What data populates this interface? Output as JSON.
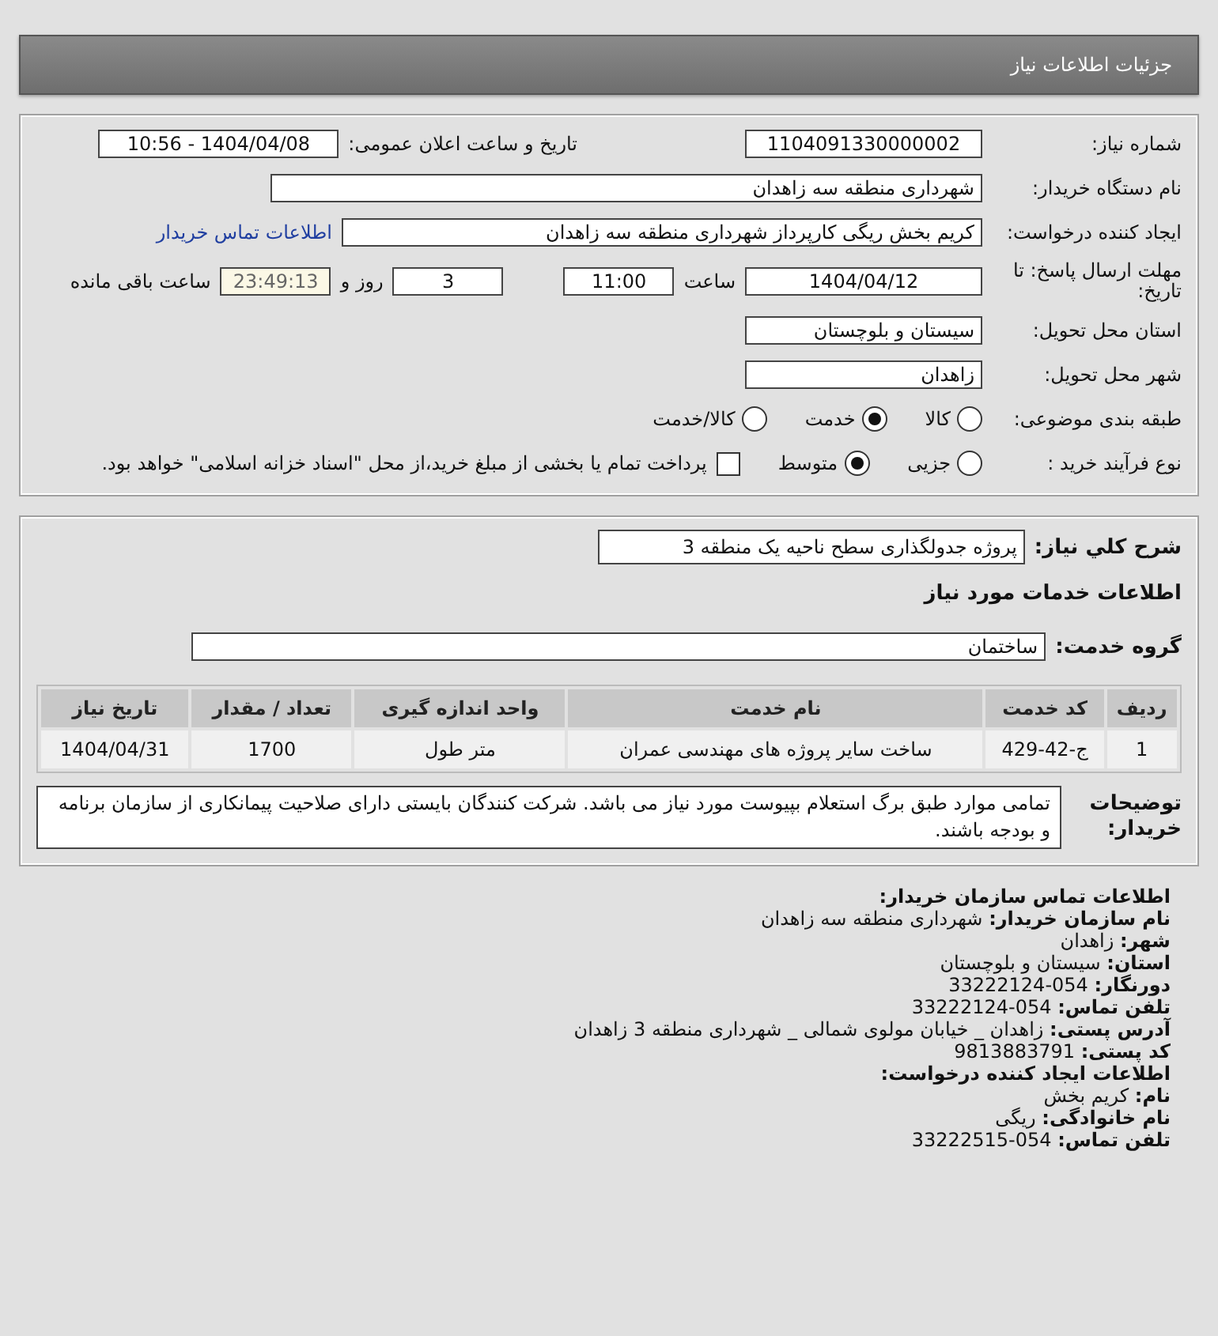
{
  "header": {
    "title": "جزئیات اطلاعات نیاز"
  },
  "details": {
    "need_number": {
      "label": "شماره نیاز:",
      "value": "1104091330000002"
    },
    "announce": {
      "label": "تاریخ و ساعت اعلان عمومی:",
      "value": "1404/04/08 - 10:56"
    },
    "buyer": {
      "label": "نام دستگاه خریدار:",
      "value": "شهرداری منطقه سه زاهدان"
    },
    "requester": {
      "label": "ایجاد کننده درخواست:",
      "value": "کریم بخش ریگی کارپرداز شهرداری منطقه سه زاهدان",
      "link": "اطلاعات تماس خریدار"
    },
    "deadline": {
      "label": "مهلت ارسال پاسخ: تا تاریخ:",
      "date": "1404/04/12",
      "time_label": "ساعت",
      "time": "11:00",
      "days": "3",
      "days_label": "روز و",
      "remaining": "23:49:13",
      "remaining_label": "ساعت باقی مانده"
    },
    "province": {
      "label": "استان محل تحویل:",
      "value": "سیستان و بلوچستان"
    },
    "city": {
      "label": "شهر محل تحویل:",
      "value": "زاهدان"
    },
    "category": {
      "label": "طبقه بندی موضوعی:",
      "options": [
        {
          "label": "کالا",
          "selected": false
        },
        {
          "label": "خدمت",
          "selected": true
        },
        {
          "label": "کالا/خدمت",
          "selected": false
        }
      ]
    },
    "process": {
      "label": "نوع فرآیند خرید :",
      "options": [
        {
          "label": "جزیی",
          "selected": false
        },
        {
          "label": "متوسط",
          "selected": true
        }
      ],
      "payment": {
        "checked": false,
        "label": "پرداخت تمام یا بخشی از مبلغ خرید،از محل \"اسناد خزانه اسلامی\" خواهد بود."
      }
    }
  },
  "summary": {
    "description": {
      "label": "شرح کلي نیاز:",
      "value": "پروژه جدولگذاری سطح ناحیه یک منطقه 3"
    },
    "services_title": "اطلاعات خدمات مورد نیاز",
    "group": {
      "label": "گروه خدمت:",
      "value": "ساختمان"
    },
    "table": {
      "columns": [
        "ردیف",
        "کد خدمت",
        "نام خدمت",
        "واحد اندازه گیری",
        "تعداد / مقدار",
        "تاریخ نیاز"
      ],
      "rows": [
        [
          "1",
          "ج-42-429",
          "ساخت سایر پروژه های مهندسی عمران",
          "متر طول",
          "1700",
          "1404/04/31"
        ]
      ]
    },
    "notes": {
      "label": "توضیحات خریدار:",
      "value": "تمامی موارد طبق برگ استعلام بپیوست مورد نیاز می باشد. شرکت کنندگان بایستی دارای صلاحیت پیمانکاری از سازمان برنامه و بودجه باشند."
    }
  },
  "contact": [
    {
      "kind": "heading",
      "label": "اطلاعات تماس سازمان خریدار:"
    },
    {
      "kind": "field",
      "label": "نام سازمان خریدار:",
      "value": "شهرداری منطقه سه زاهدان"
    },
    {
      "kind": "field",
      "label": "شهر:",
      "value": "زاهدان"
    },
    {
      "kind": "field",
      "label": "استان:",
      "value": "سیستان و بلوچستان"
    },
    {
      "kind": "field",
      "label": "دورنگار:",
      "value": "054-33222124"
    },
    {
      "kind": "field",
      "label": "تلفن تماس:",
      "value": "054-33222124"
    },
    {
      "kind": "field",
      "label": "آدرس پستی:",
      "value": "زاهدان _ خیابان مولوی شمالی _ شهرداری منطقه 3 زاهدان"
    },
    {
      "kind": "field",
      "label": "کد پستی:",
      "value": "9813883791"
    },
    {
      "kind": "heading",
      "label": "اطلاعات ایجاد کننده درخواست:"
    },
    {
      "kind": "field",
      "label": "نام:",
      "value": "کریم بخش"
    },
    {
      "kind": "field",
      "label": "نام خانوادگی:",
      "value": "ریگی"
    },
    {
      "kind": "field",
      "label": "تلفن تماس:",
      "value": "054-33222515"
    }
  ]
}
